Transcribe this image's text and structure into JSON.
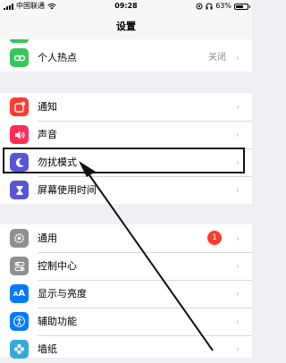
{
  "status_bar": {
    "carrier": "中国联通",
    "time": "09:28",
    "battery_percent": "63%",
    "battery_level": 0.63
  },
  "nav": {
    "title": "设置"
  },
  "groups": [
    {
      "rows": [
        {
          "label": "个人热点",
          "value": "关闭",
          "icon": "link-icon",
          "color": "#34c759"
        }
      ]
    },
    {
      "rows": [
        {
          "label": "通知",
          "icon": "notification-icon",
          "color": "#ff3b30"
        },
        {
          "label": "声音",
          "icon": "speaker-icon",
          "color": "#ff2d55"
        },
        {
          "label": "勿扰模式",
          "icon": "moon-icon",
          "color": "#5856d6"
        },
        {
          "label": "屏幕使用时间",
          "icon": "hourglass-icon",
          "color": "#5856d6"
        }
      ]
    },
    {
      "rows": [
        {
          "label": "通用",
          "icon": "gear-icon",
          "color": "#8e8e93",
          "badge": "1"
        },
        {
          "label": "控制中心",
          "icon": "toggles-icon",
          "color": "#8e8e93"
        },
        {
          "label": "显示与亮度",
          "icon": "text-size-icon",
          "color": "#007aff"
        },
        {
          "label": "辅助功能",
          "icon": "accessibility-icon",
          "color": "#007aff"
        },
        {
          "label": "墙纸",
          "icon": "flower-icon",
          "color": "#34aadc"
        }
      ]
    }
  ],
  "chevron": "›"
}
